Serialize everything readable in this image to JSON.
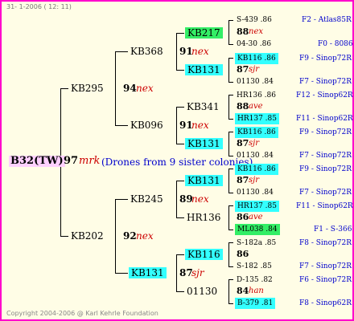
{
  "header": "31- 1-2006 ( 12: 11)",
  "footer": "Copyright 2004-2006 @ Karl Kehrle Foundation",
  "root": {
    "id": "B32(TW)",
    "num": "97",
    "code": "mrk",
    "note": "(Drones from 9 sister colonies)"
  },
  "gen1": {
    "upper": {
      "id": "KB295",
      "num": "94",
      "code": "nex"
    },
    "lower": {
      "id": "KB202",
      "num": "92",
      "code": "nex"
    }
  },
  "gen2": {
    "a": {
      "id": "KB368",
      "num": "91",
      "code": "nex"
    },
    "b": {
      "id": "KB096",
      "num": "91",
      "code": "nex"
    },
    "c": {
      "id": "KB245",
      "num": "89",
      "code": "nex"
    },
    "d": {
      "id": "KB131"
    }
  },
  "gen3": {
    "a1": {
      "id": "KB217"
    },
    "a2": {
      "id": "KB131"
    },
    "b1": {
      "id": "KB341",
      "num": "88",
      "code": "ave"
    },
    "b2": {
      "id": "KB131"
    },
    "c1": {
      "id": "KB131"
    },
    "c2": {
      "id": "HR136"
    },
    "d1": {
      "id": "KB116"
    },
    "d2": {
      "id": "01130",
      "num": "87",
      "code": "sjr"
    }
  },
  "gen4": [
    {
      "a": "S-439 .86",
      "b": "F2 - Atlas85R"
    },
    {
      "a": "88",
      "code": "nex"
    },
    {
      "a": "04-30 .86",
      "b": "F0 - 8086"
    },
    {
      "a": "KB116 .86",
      "b": "F9 - Sinop72R"
    },
    {
      "a": "87",
      "code": "sjr"
    },
    {
      "a": "01130 .84",
      "b": "F7 - Sinop72R"
    },
    {
      "a": "HR136 .86",
      "b": "F12 - Sinop62R"
    },
    {
      "a": "88",
      "code": "ave"
    },
    {
      "a": "HR137 .85",
      "b": "F11 - Sinop62R"
    },
    {
      "a": "KB116 .86",
      "b": "F9 - Sinop72R"
    },
    {
      "a": "87",
      "code": "sjr"
    },
    {
      "a": "01130 .84",
      "b": "F7 - Sinop72R"
    },
    {
      "a": "KB116 .86",
      "b": "F9 - Sinop72R"
    },
    {
      "a": "87",
      "code": "sjr"
    },
    {
      "a": "01130 .84",
      "b": "F7 - Sinop72R"
    },
    {
      "a": "HR137 .85",
      "b": "F11 - Sinop62R"
    },
    {
      "a": "86",
      "code": "ave"
    },
    {
      "a": "ML038 .84",
      "b": "F1 - S-366"
    },
    {
      "a": "S-182a .85",
      "b": "F8 - Sinop72R"
    },
    {
      "a": "86"
    },
    {
      "a": "S-182 .85",
      "b": "F7 - Sinop72R"
    },
    {
      "a": "D-135 .82",
      "b": "F6 - Sinop72R"
    },
    {
      "a": "84",
      "code": "han"
    },
    {
      "a": "B-379 .81",
      "b": "F8 - Sinop62R"
    }
  ]
}
